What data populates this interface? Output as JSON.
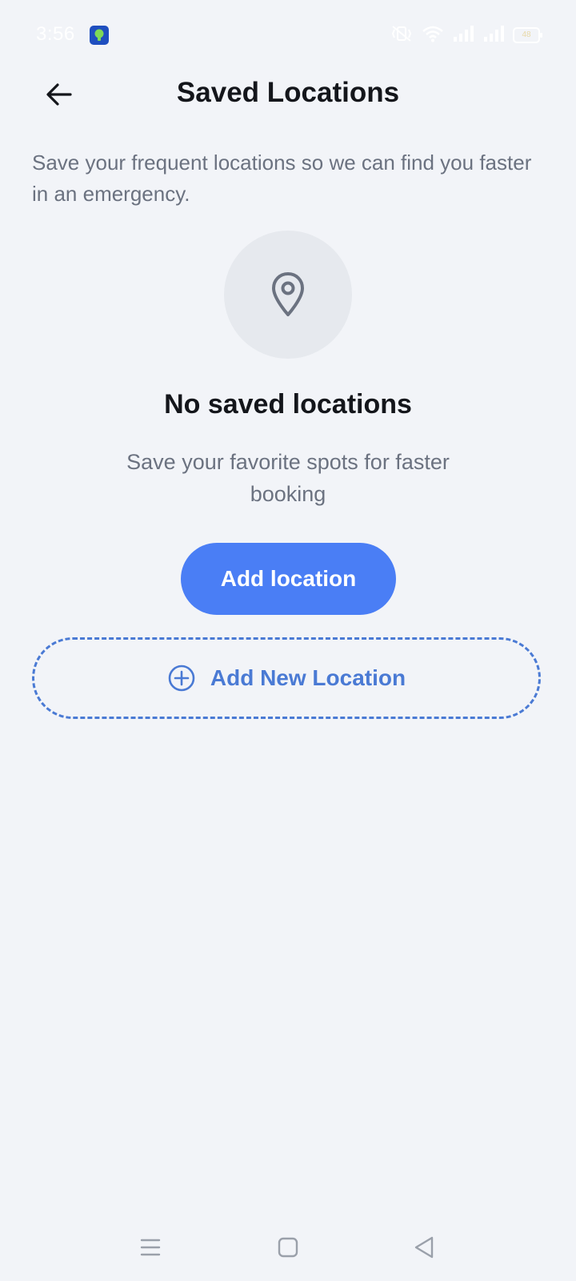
{
  "status_bar": {
    "time": "3:56",
    "battery": "48"
  },
  "header": {
    "title": "Saved Locations"
  },
  "intro": {
    "text": "Save your frequent locations so we can find you faster in an emergency."
  },
  "empty_state": {
    "title": "No saved locations",
    "subtitle": "Save your favorite spots for faster booking",
    "add_button_label": "Add location"
  },
  "add_new": {
    "label": "Add New Location"
  },
  "colors": {
    "background": "#f2f4f8",
    "accent": "#4a7ef5",
    "accent_text": "#4a7ad4",
    "muted_text": "#6b7280"
  }
}
